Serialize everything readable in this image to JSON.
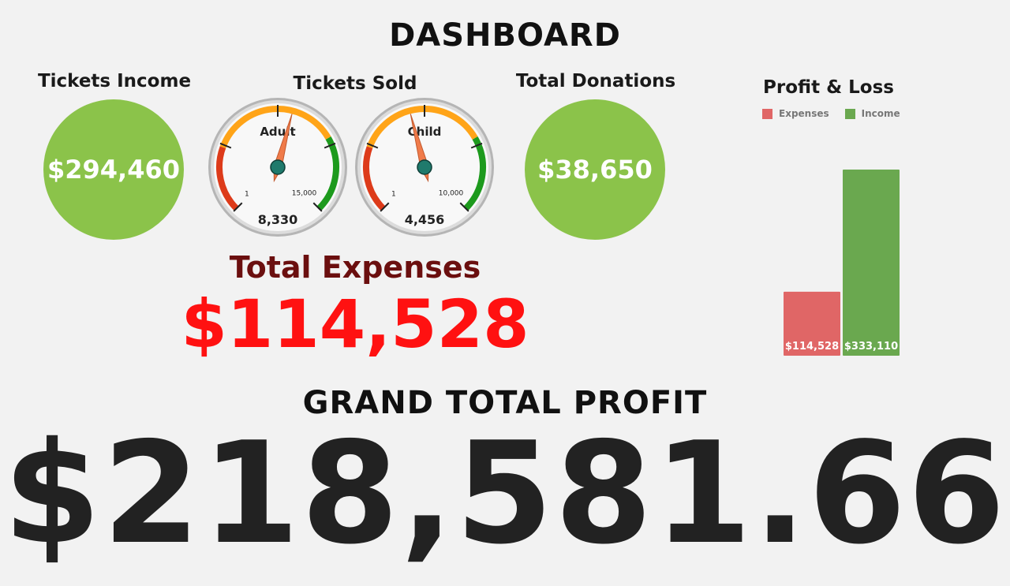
{
  "header": {
    "title": "DASHBOARD"
  },
  "tickets_income": {
    "label": "Tickets Income",
    "value": "$294,460",
    "color": "#8bc34a"
  },
  "tickets_sold": {
    "label": "Tickets Sold",
    "gauges": [
      {
        "name": "Adult",
        "value": 8330,
        "value_label": "8,330",
        "min": 1,
        "max": 15000,
        "min_label": "1",
        "max_label": "15,000"
      },
      {
        "name": "Child",
        "value": 4456,
        "value_label": "4,456",
        "min": 1,
        "max": 10000,
        "min_label": "1",
        "max_label": "10,000"
      }
    ],
    "band_colors": {
      "low": "#dd3b1a",
      "mid": "#ffa418",
      "high": "#1d9a1d"
    },
    "needle_color": "#f07b4a",
    "hub_color": "#1f7a6c"
  },
  "total_donations": {
    "label": "Total Donations",
    "value": "$38,650",
    "color": "#8bc34a"
  },
  "total_expenses": {
    "label": "Total Expenses",
    "value": "$114,528"
  },
  "grand_total": {
    "label": "GRAND TOTAL PROFIT",
    "value": "$218,581.66"
  },
  "chart_data": {
    "type": "bar",
    "title": "Profit & Loss",
    "legend_position": "top",
    "categories": [
      ""
    ],
    "series": [
      {
        "name": "Expenses",
        "values": [
          114528
        ],
        "value_labels": [
          "$114,528"
        ],
        "color": "#e06666"
      },
      {
        "name": "Income",
        "values": [
          333110
        ],
        "value_labels": [
          "$333,110"
        ],
        "color": "#6aa84f"
      }
    ],
    "ylim": [
      0,
      333110
    ],
    "grid": false
  }
}
